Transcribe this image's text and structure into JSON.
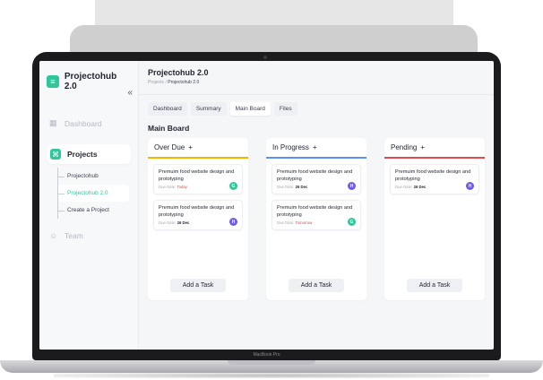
{
  "brand": {
    "name": "Projectohub 2.0",
    "logo_icon": "logo-icon"
  },
  "sidebar": {
    "collapse_glyph": "«",
    "dashboard_label": "Dashboard",
    "projects_label": "Projects",
    "sub_items": [
      "Projectohub",
      "Projectohub 2.0",
      "Create a Project"
    ],
    "team_label": "Team"
  },
  "header": {
    "title": "Projectohub 2.0",
    "breadcrumb_root": "Projects",
    "breadcrumb_sep": "/",
    "breadcrumb_current": "Projectohub 2.0"
  },
  "tabs": [
    "Dashboard",
    "Summary",
    "Main Board",
    "Files"
  ],
  "active_tab": "Main Board",
  "board_title": "Main Board",
  "columns": [
    {
      "title": "Over Due",
      "plus": "+",
      "accent": "#f5b400",
      "cards": [
        {
          "title": "Premuim food website design and prototyping",
          "due_label": "Due Date:",
          "due_value": "Today",
          "due_red": true,
          "avatar": "G",
          "avatar_color": "#2fc69c"
        },
        {
          "title": "Premuim food website design and prototyping",
          "due_label": "Due Date:",
          "due_value": "26 Dec",
          "due_red": false,
          "avatar": "H",
          "avatar_color": "#6c5ce7"
        }
      ],
      "add_label": "Add a Task"
    },
    {
      "title": "In Progress",
      "plus": "+",
      "accent": "#5b8ff9",
      "cards": [
        {
          "title": "Premuim food website design and prototyping",
          "due_label": "Due Date:",
          "due_value": "26 Dec",
          "due_red": false,
          "avatar": "H",
          "avatar_color": "#6c5ce7"
        },
        {
          "title": "Premuim food website design and prototyping",
          "due_label": "Due Date:",
          "due_value": "Tomorrow",
          "due_red": true,
          "avatar": "G",
          "avatar_color": "#2fc69c"
        }
      ],
      "add_label": "Add a Task"
    },
    {
      "title": "Pending",
      "plus": "+",
      "accent": "#e5484d",
      "cards": [
        {
          "title": "Premuim food website design and prototyping",
          "due_label": "Due Date:",
          "due_value": "26 Dec",
          "due_red": false,
          "avatar": "H",
          "avatar_color": "#6c5ce7"
        }
      ],
      "add_label": "Add a Task"
    }
  ],
  "device_label": "MacBook Pro"
}
